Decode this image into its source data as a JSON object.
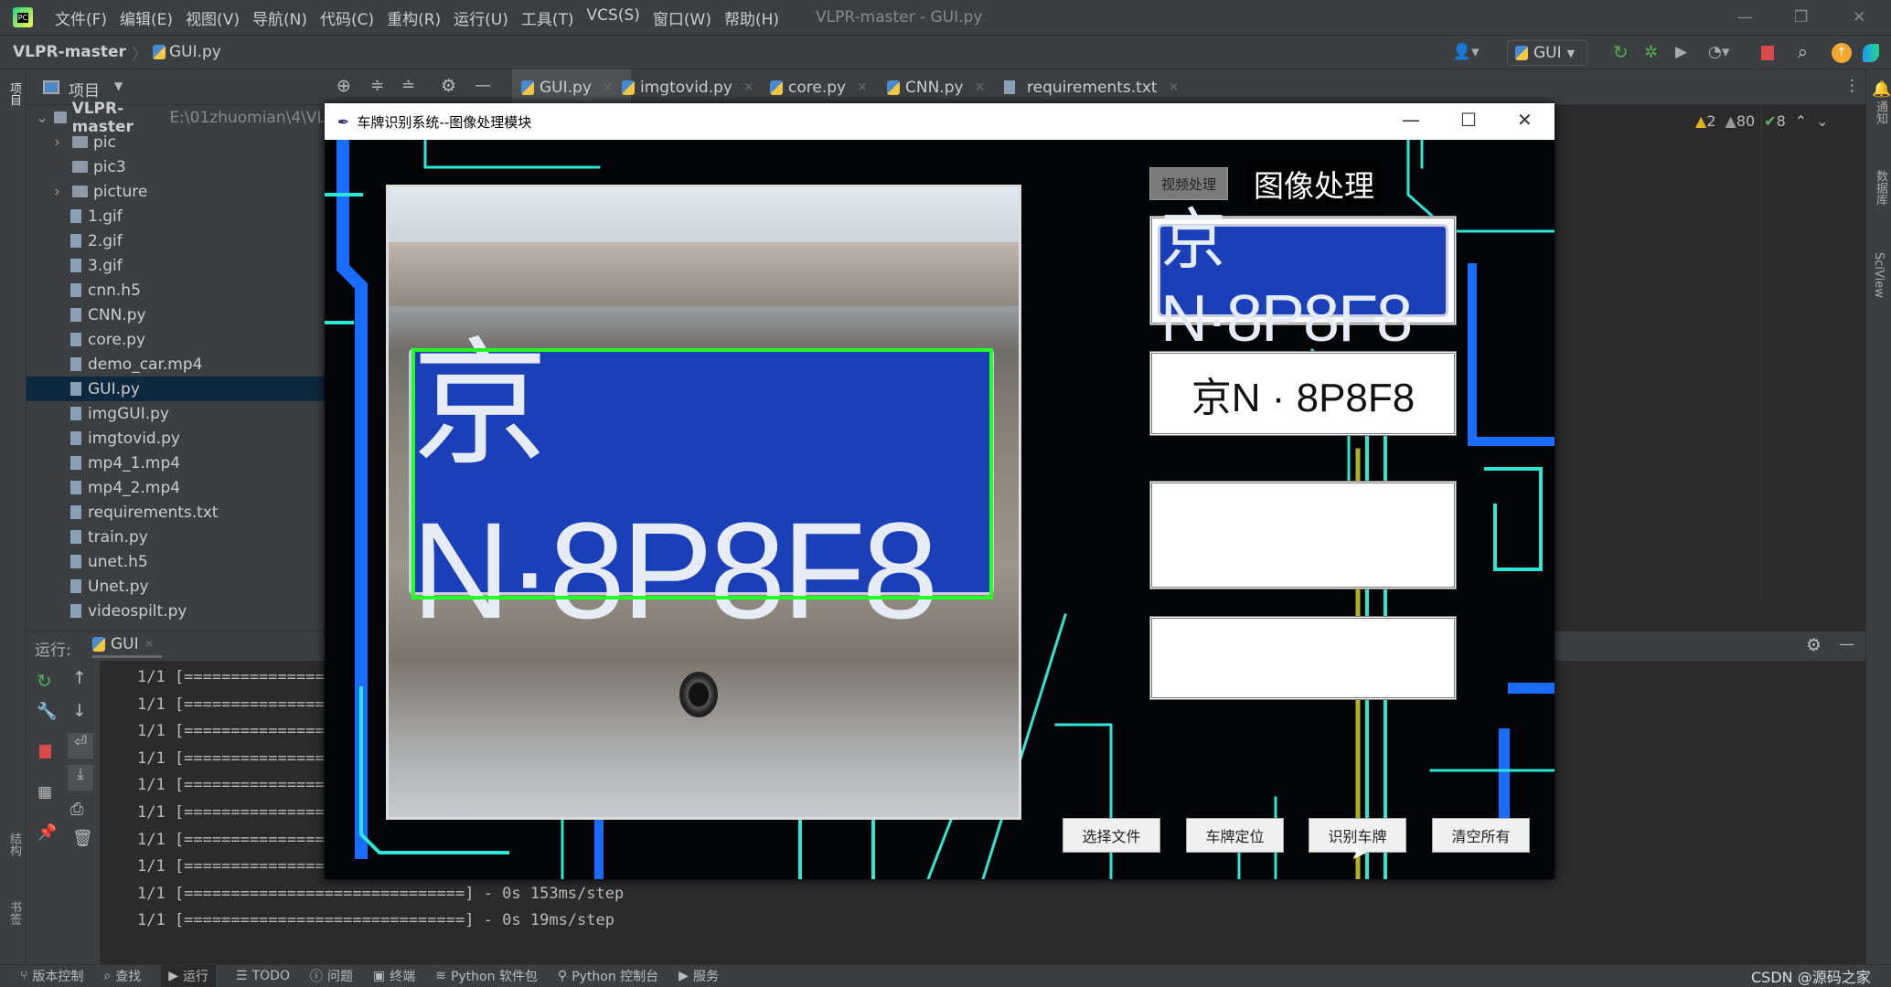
{
  "ide": {
    "app_logo": "PC",
    "menu": [
      "文件(F)",
      "编辑(E)",
      "视图(V)",
      "导航(N)",
      "代码(C)",
      "重构(R)",
      "运行(U)",
      "工具(T)",
      "VCS(S)",
      "窗口(W)",
      "帮助(H)"
    ],
    "window_title": "VLPR-master - GUI.py",
    "breadcrumb": {
      "project": "VLPR-master",
      "file": "GUI.py"
    },
    "run_config": "GUI",
    "project_panel_label": "项目",
    "left_strip_label": "项目",
    "tabs": [
      {
        "label": "GUI.py",
        "active": true
      },
      {
        "label": "imgtovid.py"
      },
      {
        "label": "core.py"
      },
      {
        "label": "CNN.py"
      },
      {
        "label": "requirements.txt"
      }
    ],
    "inspections": {
      "warnings": "2",
      "weak_warnings": "80",
      "typos": "8"
    },
    "tree": [
      {
        "label": "VLPR-master",
        "path": "E:\\01zhuomian\\4\\VL",
        "type": "root"
      },
      {
        "label": "pic",
        "type": "folder"
      },
      {
        "label": "pic3",
        "type": "folder"
      },
      {
        "label": "picture",
        "type": "folder"
      },
      {
        "label": "1.gif"
      },
      {
        "label": "2.gif"
      },
      {
        "label": "3.gif"
      },
      {
        "label": "cnn.h5"
      },
      {
        "label": "CNN.py"
      },
      {
        "label": "core.py"
      },
      {
        "label": "demo_car.mp4"
      },
      {
        "label": "GUI.py",
        "selected": true
      },
      {
        "label": "imgGUI.py"
      },
      {
        "label": "imgtovid.py"
      },
      {
        "label": "mp4_1.mp4"
      },
      {
        "label": "mp4_2.mp4"
      },
      {
        "label": "requirements.txt"
      },
      {
        "label": "train.py"
      },
      {
        "label": "unet.h5"
      },
      {
        "label": "Unet.py"
      },
      {
        "label": "videospilt.py"
      }
    ],
    "run": {
      "label": "运行:",
      "tab": "GUI",
      "lines": [
        "1/1 [=================",
        "1/1 [=================",
        "1/1 [=================",
        "1/1 [=================",
        "1/1 [=================",
        "1/1 [=================",
        "1/1 [=================",
        "1/1 [=================",
        "1/1 [==============================] - 0s 153ms/step",
        "1/1 [==============================] - 0s 19ms/step"
      ]
    },
    "right_strip": [
      "通知",
      "数据库",
      "SciView"
    ],
    "left_strip_bottom": [
      "结构",
      "书签"
    ],
    "statusbar": [
      "版本控制",
      "查找",
      "运行",
      "TODO",
      "问题",
      "终端",
      "Python 软件包",
      "Python 控制台",
      "服务"
    ],
    "watermark": "CSDN @源码之家"
  },
  "gui": {
    "title": "车牌识别系统--图像处理模块",
    "video_button": "视频处理",
    "heading": "图像处理",
    "plate_image_text": "京N·8P8F8",
    "main_plate_text": "京N·8P8F8",
    "result_text": "京N · 8P8F8",
    "buttons": [
      "选择文件",
      "车牌定位",
      "识别车牌",
      "清空所有"
    ],
    "plate_color": "#1b3fb8",
    "detection_box_color": "#22ff22"
  }
}
